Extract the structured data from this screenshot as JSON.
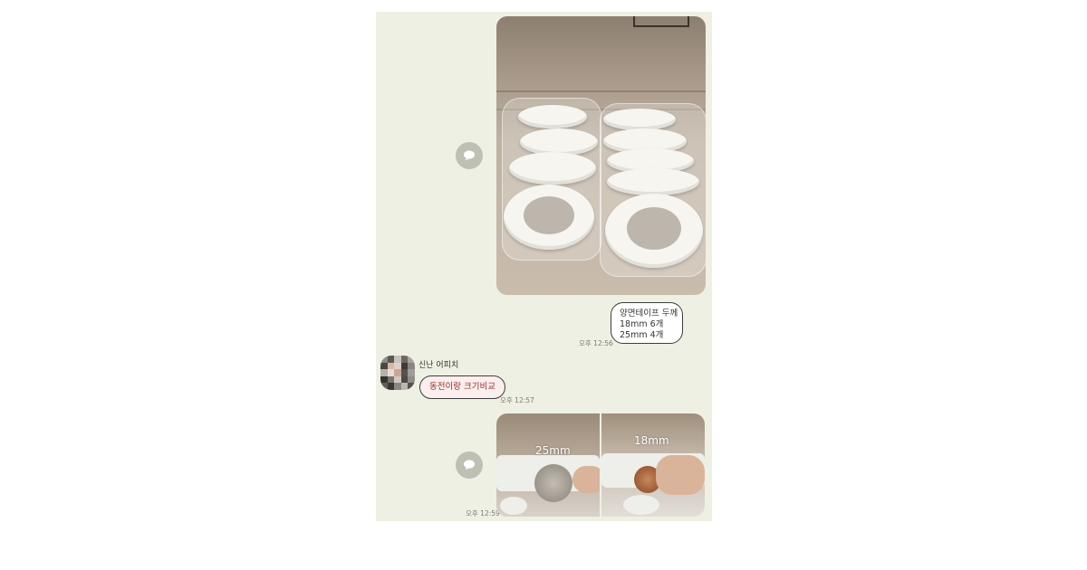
{
  "messages": {
    "tape_info": {
      "line1": "양면테이프 두께",
      "line2": "18mm 6개",
      "line3": "25mm 4개",
      "time": "오후 12:56"
    },
    "sender": {
      "name": "신난 어피치",
      "text": "동전이랑 크기비교",
      "time": "오후 12:57"
    },
    "photos": {
      "left_caption": "25mm",
      "right_caption": "18mm",
      "time": "오후 12:59"
    }
  },
  "icons": {
    "share": "speech-bubble-share-icon"
  },
  "colors": {
    "chat_background": "#eef0e3",
    "sender_bubble": "#fbeeee"
  }
}
